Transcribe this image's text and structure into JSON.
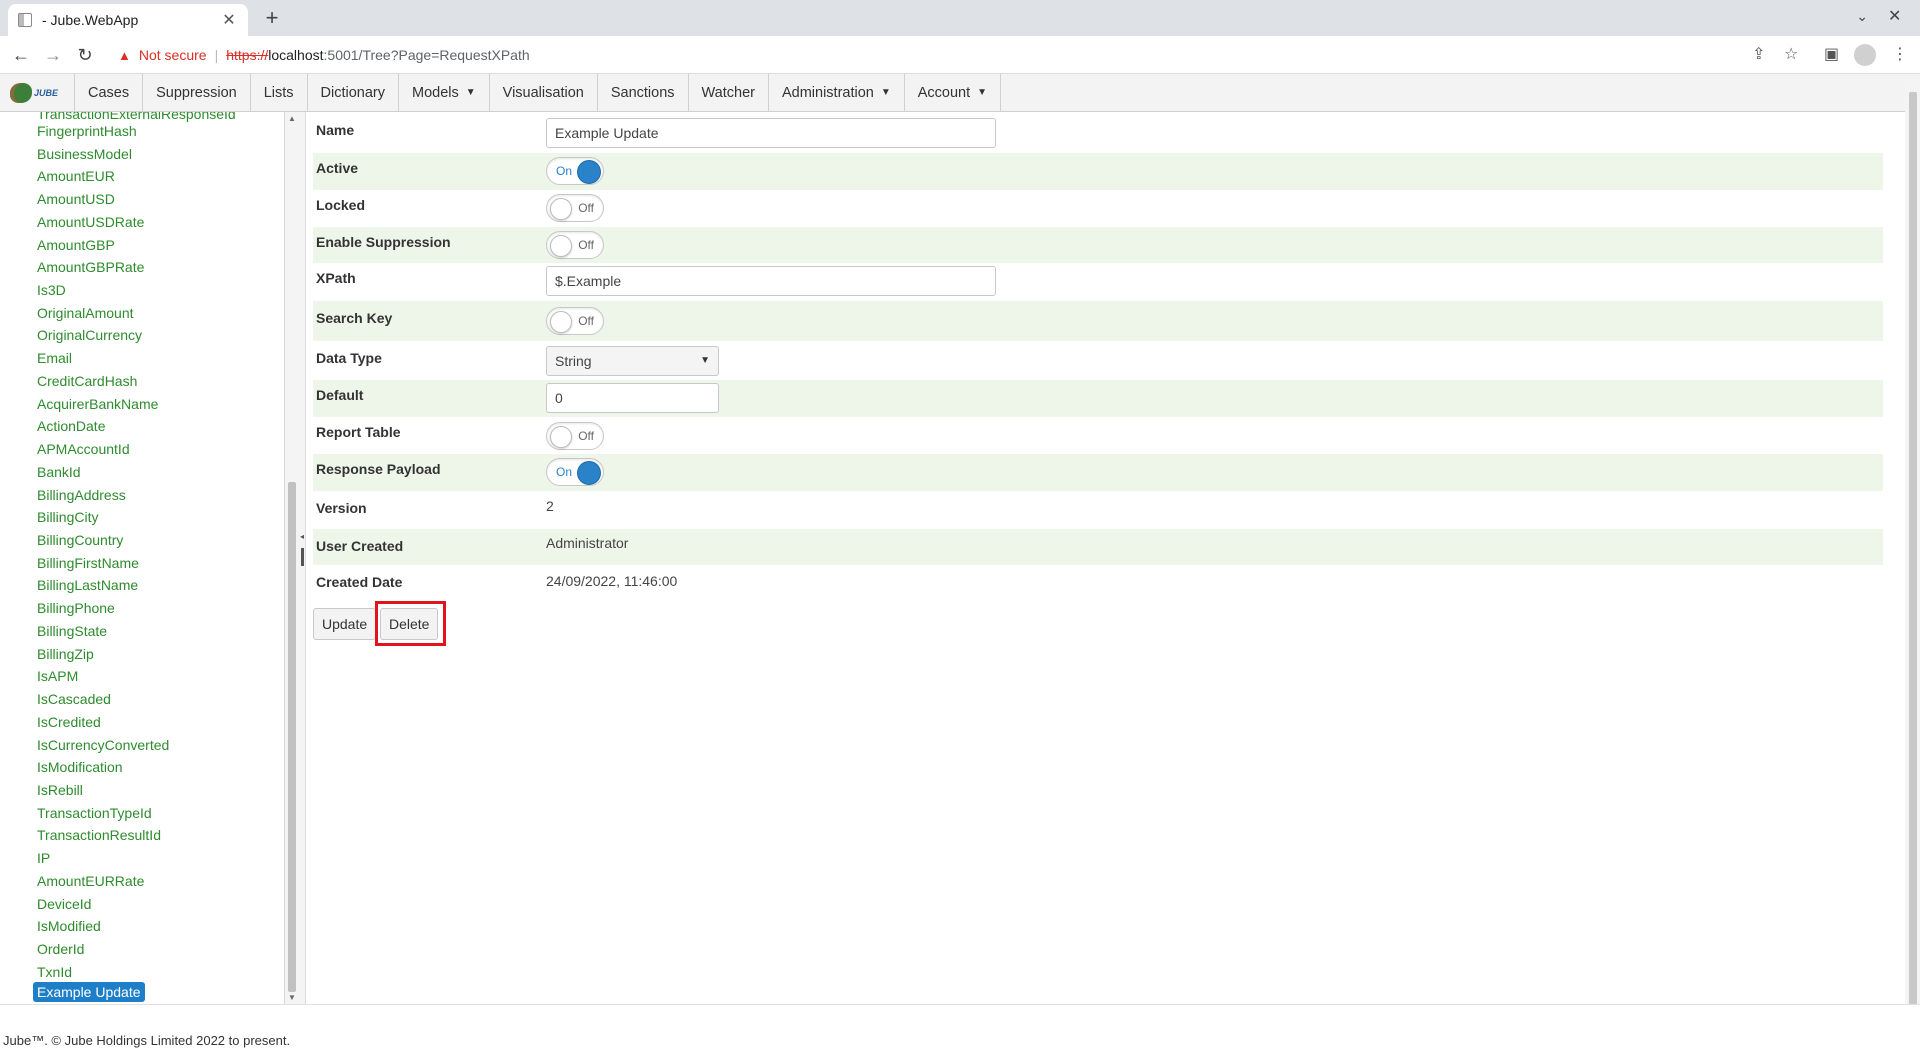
{
  "browser": {
    "tab_title": "- Jube.WebApp",
    "not_secure": "Not secure",
    "url_scheme": "https://",
    "url_host": "localhost",
    "url_path": ":5001/Tree?Page=RequestXPath"
  },
  "menu": {
    "items": [
      "Cases",
      "Suppression",
      "Lists",
      "Dictionary",
      "Models",
      "Visualisation",
      "Sanctions",
      "Watcher",
      "Administration",
      "Account"
    ],
    "logo_text": "JUBE"
  },
  "tree": {
    "items": [
      "TransactionExternalResponseId",
      "FingerprintHash",
      "BusinessModel",
      "AmountEUR",
      "AmountUSD",
      "AmountUSDRate",
      "AmountGBP",
      "AmountGBPRate",
      "Is3D",
      "OriginalAmount",
      "OriginalCurrency",
      "Email",
      "CreditCardHash",
      "AcquirerBankName",
      "ActionDate",
      "APMAccountId",
      "BankId",
      "BillingAddress",
      "BillingCity",
      "BillingCountry",
      "BillingFirstName",
      "BillingLastName",
      "BillingPhone",
      "BillingState",
      "BillingZip",
      "IsAPM",
      "IsCascaded",
      "IsCredited",
      "IsCurrencyConverted",
      "IsModification",
      "IsRebill",
      "TransactionTypeId",
      "TransactionResultId",
      "IP",
      "AmountEURRate",
      "DeviceId",
      "IsModified",
      "OrderId",
      "TxnId"
    ],
    "selected": "Example Update"
  },
  "form": {
    "name_label": "Name",
    "name_value": "Example Update",
    "active_label": "Active",
    "active_state": "On",
    "locked_label": "Locked",
    "locked_state": "Off",
    "suppression_label": "Enable Suppression",
    "suppression_state": "Off",
    "xpath_label": "XPath",
    "xpath_value": "$.Example",
    "searchkey_label": "Search Key",
    "searchkey_state": "Off",
    "datatype_label": "Data Type",
    "datatype_value": "String",
    "default_label": "Default",
    "default_value": "0",
    "reporttable_label": "Report Table",
    "reporttable_state": "Off",
    "response_label": "Response Payload",
    "response_state": "On",
    "version_label": "Version",
    "version_value": "2",
    "usercreated_label": "User Created",
    "usercreated_value": "Administrator",
    "createddate_label": "Created Date",
    "createddate_value": "24/09/2022, 11:46:00",
    "update_button": "Update",
    "delete_button": "Delete"
  },
  "footer": {
    "text": "Jube™. © Jube Holdings Limited 2022 to present."
  },
  "colors": {
    "accent": "#1e7fc8",
    "tree_link": "#2e8b2e",
    "row_alt": "#eef6ea",
    "highlight": "#e0141c"
  }
}
